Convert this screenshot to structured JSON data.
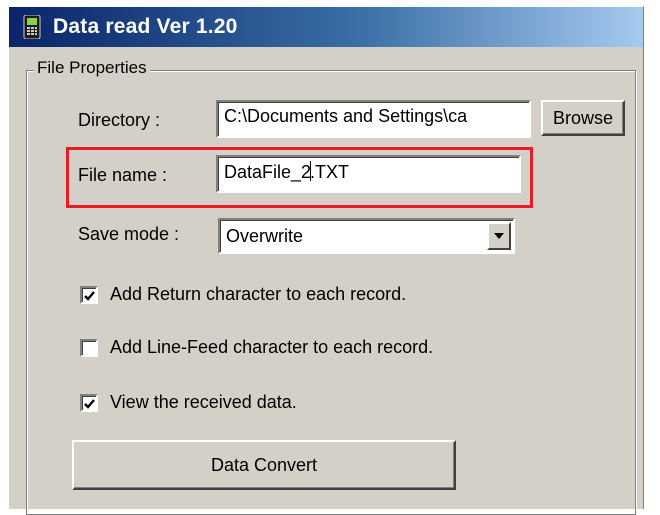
{
  "window": {
    "title": "Data read  Ver 1.20",
    "icon": "handheld-terminal-icon"
  },
  "group": {
    "legend": "File Properties"
  },
  "directory": {
    "label": "Directory :",
    "value": "C:\\Documents and Settings\\ca",
    "browse_label": "Browse"
  },
  "filename": {
    "label": "File name :",
    "value_before_caret": "DataFile_2",
    "value_after_caret": ".TXT"
  },
  "save_mode": {
    "label": "Save mode :",
    "selected": "Overwrite"
  },
  "options": [
    {
      "label": "Add Return character to each record.",
      "checked": true
    },
    {
      "label": "Add Line-Feed character to each record.",
      "checked": false
    },
    {
      "label": "View the received data.",
      "checked": true
    }
  ],
  "convert_button": {
    "label": "Data Convert"
  },
  "colors": {
    "highlight": "#e81c24",
    "titlebar_start": "#0a246a",
    "titlebar_end": "#a6caf0",
    "face": "#d4d0c8"
  }
}
